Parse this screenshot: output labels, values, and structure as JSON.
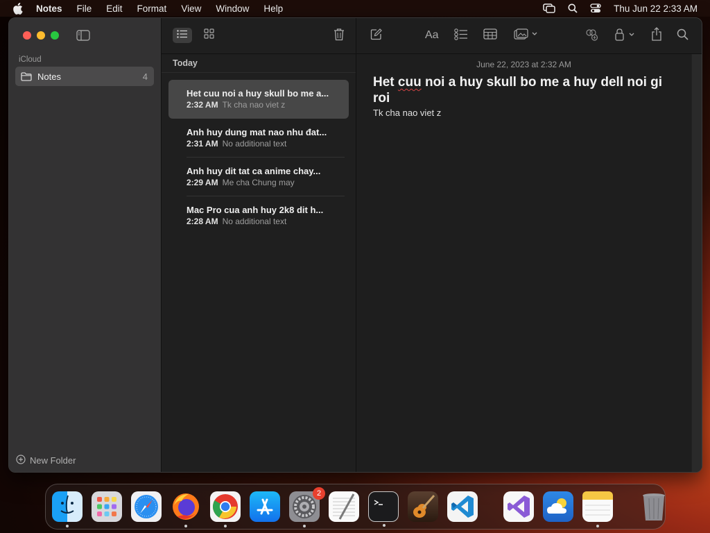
{
  "menubar": {
    "app_name": "Notes",
    "menus": [
      "File",
      "Edit",
      "Format",
      "View",
      "Window",
      "Help"
    ],
    "clock": "Thu Jun 22  2:33 AM"
  },
  "sidebar": {
    "section_label": "iCloud",
    "folder": {
      "label": "Notes",
      "count": "4"
    },
    "new_folder_label": "New Folder"
  },
  "note_list": {
    "group_header": "Today",
    "notes": [
      {
        "title": "Het cuu noi a huy skull bo me a...",
        "time": "2:32 AM",
        "preview": "Tk cha nao viet z"
      },
      {
        "title": "Anh huy dung mat nao nhu đat...",
        "time": "2:31 AM",
        "preview": "No additional text"
      },
      {
        "title": "Anh huy dit tat ca anime chay...",
        "time": "2:29 AM",
        "preview": "Me cha Chung may"
      },
      {
        "title": "Mac Pro cua anh huy 2k8 dit h...",
        "time": "2:28 AM",
        "preview": "No additional text"
      }
    ]
  },
  "editor": {
    "date": "June 22, 2023 at 2:32 AM",
    "title_word_1": "Het ",
    "title_word_2": "cuu",
    "title_rest": " noi a huy skull bo me a huy dell noi gi roi",
    "body": "Tk cha nao viet z"
  },
  "dock": {
    "apps": [
      "finder",
      "launchpad",
      "safari",
      "firefox",
      "chrome",
      "app-store",
      "system-settings",
      "textedit",
      "terminal",
      "garageband",
      "vscode",
      "visual-studio",
      "weather",
      "notes",
      "trash"
    ],
    "system_settings_badge": "2"
  },
  "colors": {
    "close": "#ff5f57",
    "minimize": "#febc2e",
    "zoom": "#28c840",
    "accent_yellow": "#f6c744"
  }
}
